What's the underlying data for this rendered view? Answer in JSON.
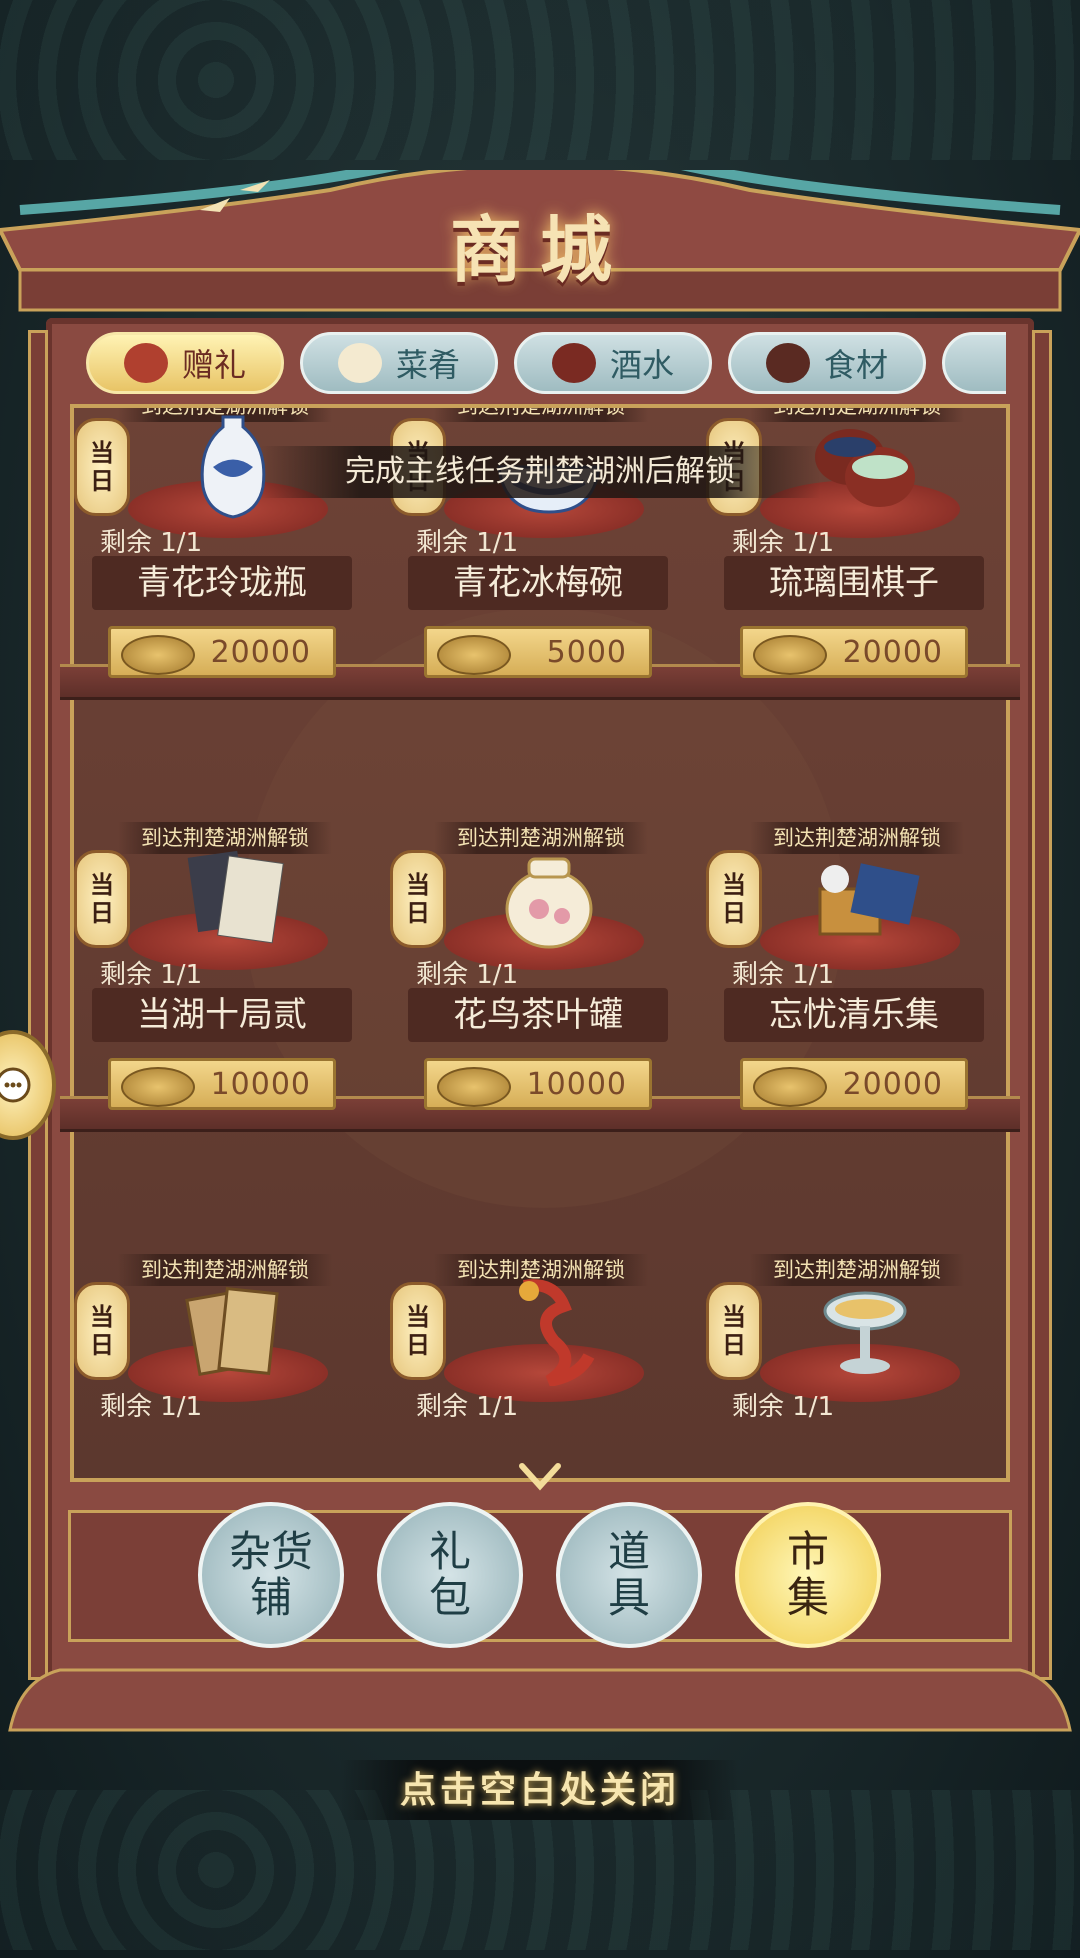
{
  "header": {
    "title": "商城"
  },
  "tabs": [
    {
      "label": "赠礼",
      "icon": "gift-chest-icon",
      "active": true
    },
    {
      "label": "菜肴",
      "icon": "dumplings-icon",
      "active": false
    },
    {
      "label": "酒水",
      "icon": "wine-jar-icon",
      "active": false
    },
    {
      "label": "食材",
      "icon": "ingredients-icon",
      "active": false
    }
  ],
  "notice": "完成主线任务荆楚湖洲后解锁",
  "items": [
    {
      "lock": "到达荆楚湖洲解锁",
      "daily": "当日",
      "remain": "剩余 1/1",
      "name": "青花玲珑瓶",
      "price": "20000",
      "icon": "vase-icon"
    },
    {
      "lock": "到达荆楚湖洲解锁",
      "daily": "当日",
      "remain": "剩余 1/1",
      "name": "青花冰梅碗",
      "price": "5000",
      "icon": "bowl-icon"
    },
    {
      "lock": "到达荆楚湖洲解锁",
      "daily": "当日",
      "remain": "剩余 1/1",
      "name": "琉璃围棋子",
      "price": "20000",
      "icon": "go-stones-icon"
    },
    {
      "lock": "到达荆楚湖洲解锁",
      "daily": "当日",
      "remain": "剩余 1/1",
      "name": "当湖十局贰",
      "price": "10000",
      "icon": "book-icon"
    },
    {
      "lock": "到达荆楚湖洲解锁",
      "daily": "当日",
      "remain": "剩余 1/1",
      "name": "花鸟茶叶罐",
      "price": "10000",
      "icon": "tea-jar-icon"
    },
    {
      "lock": "到达荆楚湖洲解锁",
      "daily": "当日",
      "remain": "剩余 1/1",
      "name": "忘忧清乐集",
      "price": "20000",
      "icon": "go-board-icon"
    },
    {
      "lock": "到达荆楚湖洲解锁",
      "daily": "当日",
      "remain": "剩余 1/1",
      "name": "",
      "price": "",
      "icon": "scroll-books-icon"
    },
    {
      "lock": "到达荆楚湖洲解锁",
      "daily": "当日",
      "remain": "剩余 1/1",
      "name": "",
      "price": "",
      "icon": "dragon-icon"
    },
    {
      "lock": "到达荆楚湖洲解锁",
      "daily": "当日",
      "remain": "剩余 1/1",
      "name": "",
      "price": "",
      "icon": "goblet-icon"
    }
  ],
  "bottom_nav": [
    {
      "label": "杂货铺",
      "active": false
    },
    {
      "label": "礼包",
      "active": false
    },
    {
      "label": "道具",
      "active": false
    },
    {
      "label": "市集",
      "active": true
    }
  ],
  "close_hint": "点击空白处关闭",
  "colors": {
    "frame": "#8a4a41",
    "gold": "#c9a25a",
    "tab_active": "#e8c466",
    "tab_inactive": "#9fbcc1"
  }
}
